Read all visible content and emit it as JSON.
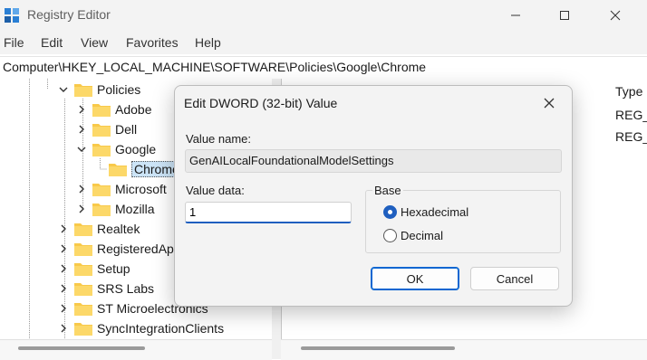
{
  "window": {
    "title": "Registry Editor",
    "icon": "regedit-icon"
  },
  "menu": [
    "File",
    "Edit",
    "View",
    "Favorites",
    "Help"
  ],
  "address": "Computer\\HKEY_LOCAL_MACHINE\\SOFTWARE\\Policies\\Google\\Chrome",
  "tree": {
    "items": [
      {
        "label": "Policies",
        "expanded": true
      },
      {
        "label": "Adobe",
        "expanded": false
      },
      {
        "label": "Dell",
        "expanded": false
      },
      {
        "label": "Google",
        "expanded": true
      },
      {
        "label": "Chrome",
        "selected": true
      },
      {
        "label": "Microsoft",
        "expanded": false
      },
      {
        "label": "Mozilla",
        "expanded": false
      },
      {
        "label": "Realtek",
        "expanded": false
      },
      {
        "label": "RegisteredAp",
        "expanded": false
      },
      {
        "label": "Setup",
        "expanded": false
      },
      {
        "label": "SRS Labs",
        "expanded": false
      },
      {
        "label": "ST Microelectronics",
        "expanded": false
      },
      {
        "label": "SyncIntegrationClients",
        "expanded": false
      }
    ]
  },
  "values_pane": {
    "column_type": "Type",
    "rows": [
      "REG_",
      "REG_"
    ]
  },
  "dialog": {
    "title": "Edit DWORD (32-bit) Value",
    "value_name_label": "Value name:",
    "value_name": "GenAILocalFoundationalModelSettings",
    "value_data_label": "Value data:",
    "value_data": "1",
    "base_label": "Base",
    "base_options": [
      {
        "label": "Hexadecimal",
        "selected": true
      },
      {
        "label": "Decimal",
        "selected": false
      }
    ],
    "ok_label": "OK",
    "cancel_label": "Cancel"
  },
  "colors": {
    "accent": "#1f5fbf",
    "folder": "#f8c94a",
    "selection": "#cce4f7"
  }
}
